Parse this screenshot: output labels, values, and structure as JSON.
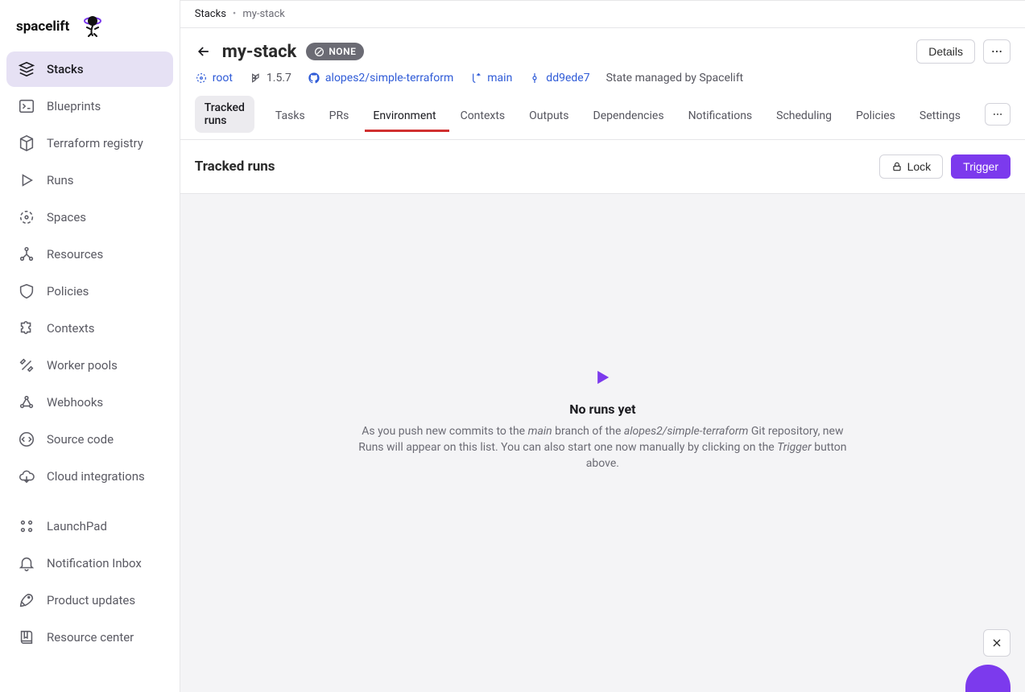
{
  "brand": "spacelift",
  "sidebar": {
    "items": [
      {
        "label": "Stacks",
        "active": true,
        "icon": "stacks-icon"
      },
      {
        "label": "Blueprints",
        "icon": "blueprints-icon"
      },
      {
        "label": "Terraform registry",
        "icon": "cube-icon"
      },
      {
        "label": "Runs",
        "icon": "play-outline-icon"
      },
      {
        "label": "Spaces",
        "icon": "target-icon"
      },
      {
        "label": "Resources",
        "icon": "nodes-icon"
      },
      {
        "label": "Policies",
        "icon": "shield-icon"
      },
      {
        "label": "Contexts",
        "icon": "puzzle-icon"
      },
      {
        "label": "Worker pools",
        "icon": "tools-icon"
      },
      {
        "label": "Webhooks",
        "icon": "webhook-icon"
      },
      {
        "label": "Source code",
        "icon": "code-icon"
      },
      {
        "label": "Cloud integrations",
        "icon": "cloud-icon"
      }
    ],
    "footer": [
      {
        "label": "LaunchPad",
        "icon": "apps-icon"
      },
      {
        "label": "Notification Inbox",
        "icon": "bell-icon"
      },
      {
        "label": "Product updates",
        "icon": "rocket-icon"
      },
      {
        "label": "Resource center",
        "icon": "book-icon"
      }
    ]
  },
  "breadcrumbs": {
    "root": "Stacks",
    "leaf": "my-stack"
  },
  "stack": {
    "title": "my-stack",
    "badge": "NONE",
    "details_label": "Details",
    "meta": {
      "scope": "root",
      "version": "1.5.7",
      "repo": "alopes2/simple-terraform",
      "branch": "main",
      "commit": "dd9ede7",
      "state_text": "State managed by Spacelift"
    }
  },
  "tabs": [
    {
      "label": "Tracked runs",
      "type": "pill"
    },
    {
      "label": "Tasks"
    },
    {
      "label": "PRs"
    },
    {
      "label": "Environment",
      "type": "highlight"
    },
    {
      "label": "Contexts"
    },
    {
      "label": "Outputs"
    },
    {
      "label": "Dependencies"
    },
    {
      "label": "Notifications"
    },
    {
      "label": "Scheduling"
    },
    {
      "label": "Policies"
    },
    {
      "label": "Settings"
    }
  ],
  "sub": {
    "heading": "Tracked runs",
    "lock_label": "Lock",
    "trigger_label": "Trigger"
  },
  "empty": {
    "title": "No runs yet",
    "p1": "As you push new commits to the ",
    "branch": "main",
    "p2": " branch of the ",
    "repo": "alopes2/simple-terraform",
    "p3": " Git repository, new Runs will appear on this list. You can also start one now manually by clicking on the ",
    "trigger": "Trigger",
    "p4": " button above."
  }
}
